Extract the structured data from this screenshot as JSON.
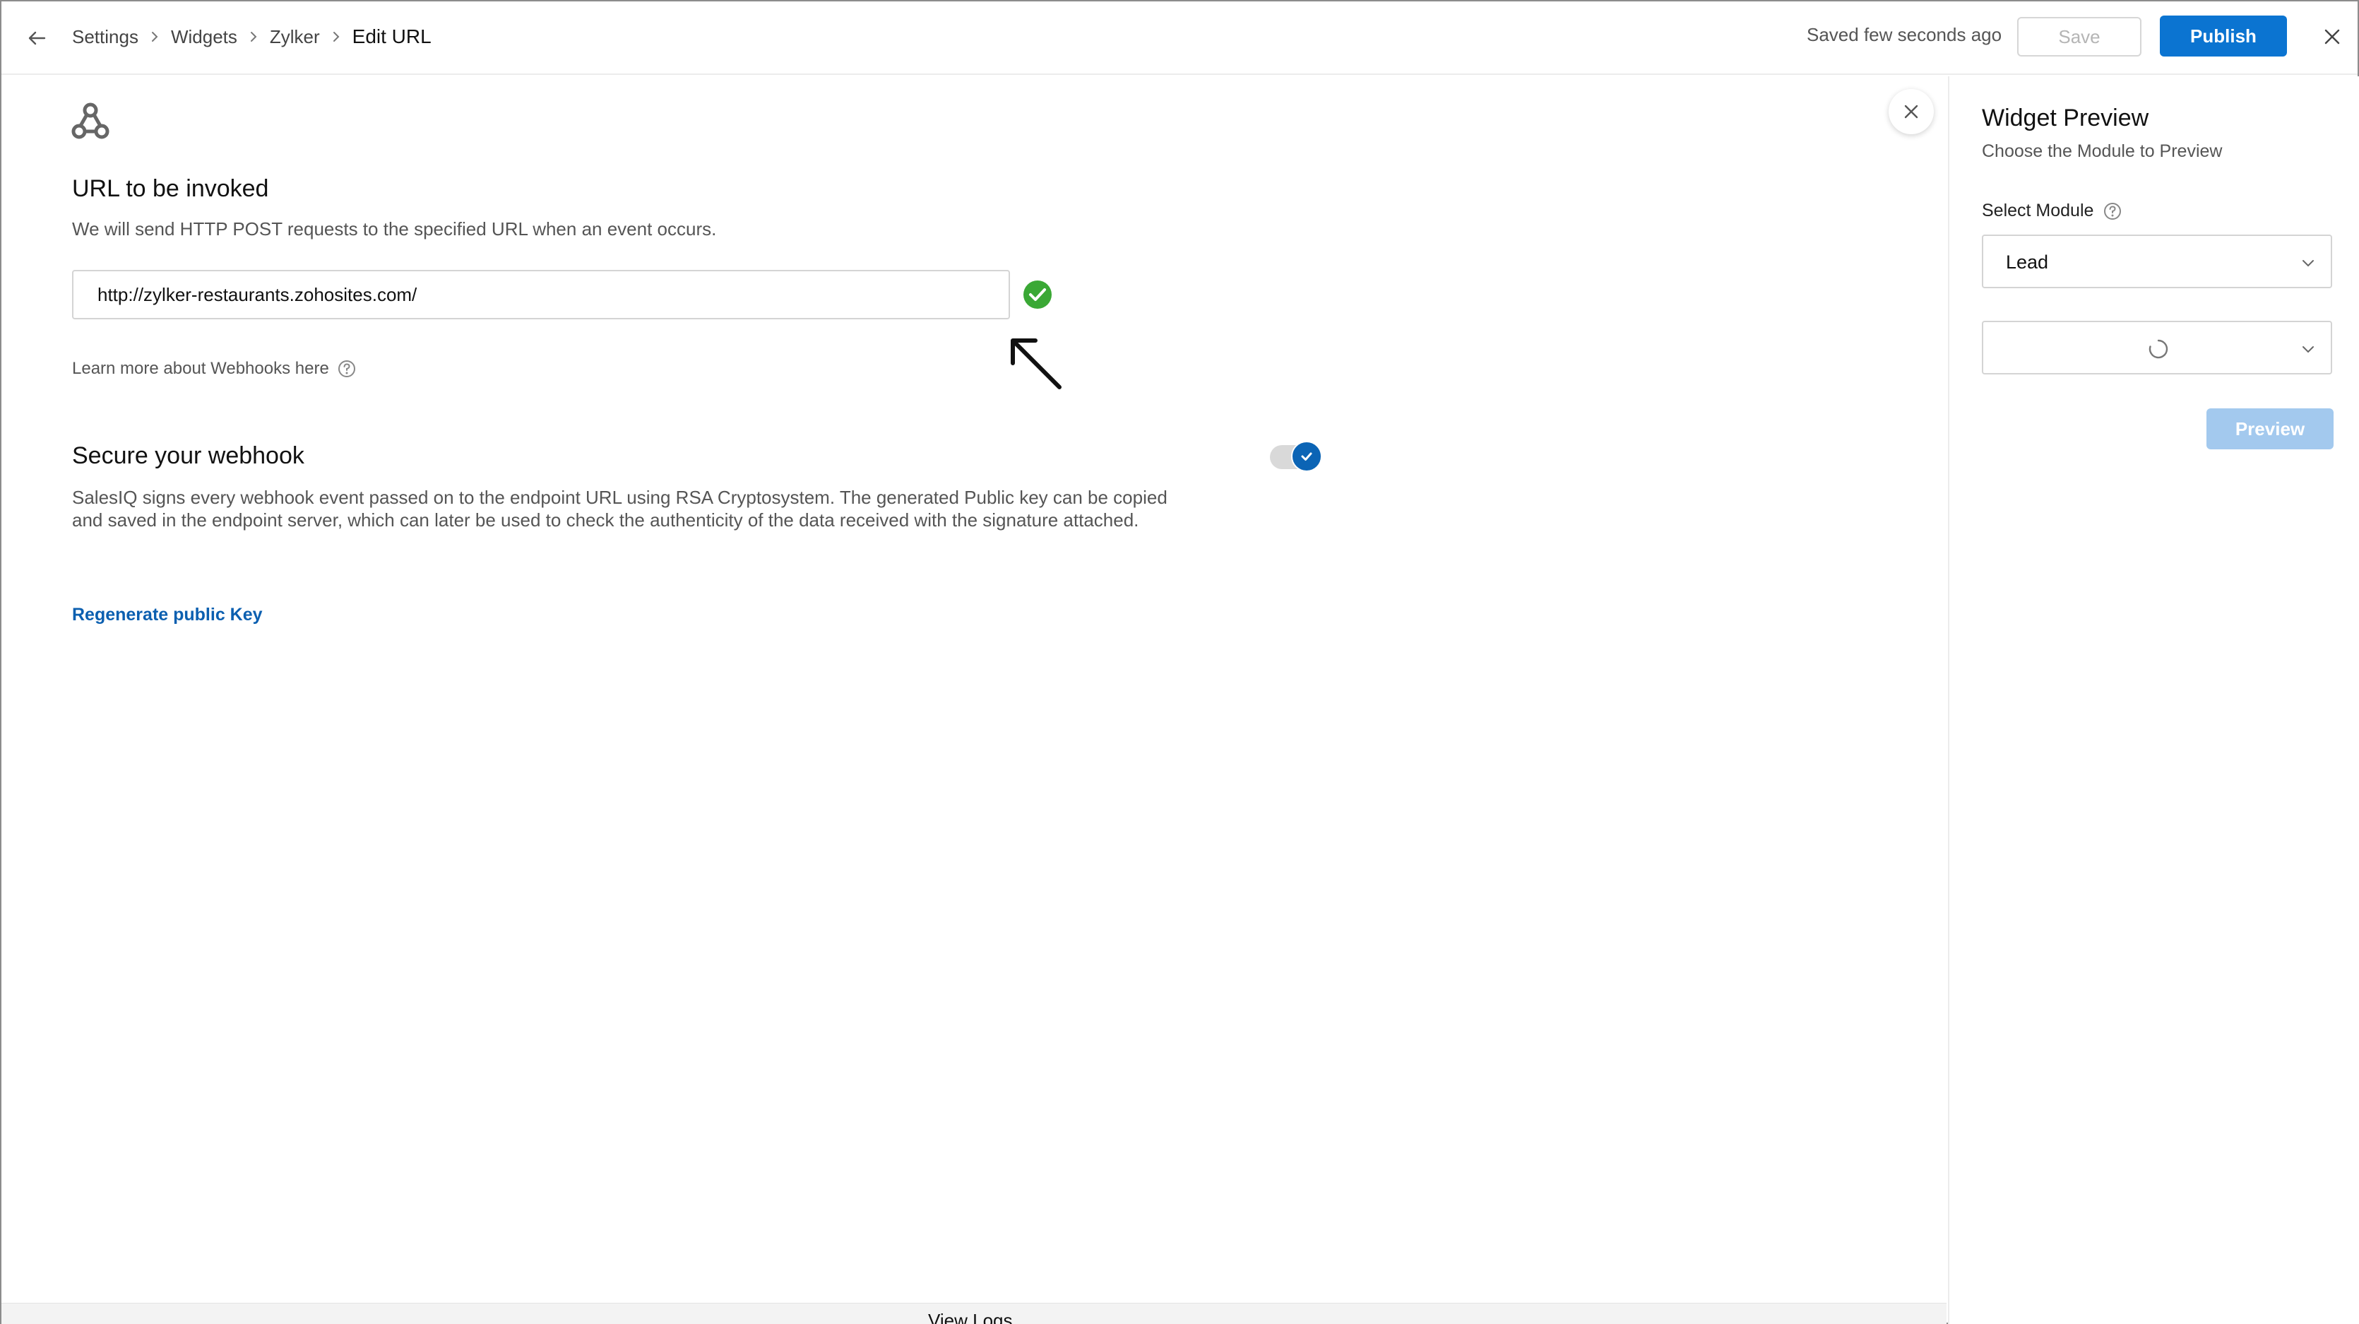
{
  "breadcrumb": {
    "items": [
      "Settings",
      "Widgets",
      "Zylker"
    ],
    "current": "Edit URL"
  },
  "header": {
    "saved_status": "Saved few seconds ago",
    "save_label": "Save",
    "publish_label": "Publish"
  },
  "url_section": {
    "title": "URL to be invoked",
    "description": "We will send HTTP POST requests to the specified URL when an event occurs.",
    "url_value": "http://zylker-restaurants.zohosites.com/",
    "learn_more": "Learn more about Webhooks here"
  },
  "secure_section": {
    "title": "Secure your webhook",
    "description": "SalesIQ signs every webhook event passed on to the endpoint URL using RSA Cryptosystem. The generated Public key can be copied and saved in the endpoint server, which can later be used to check the authenticity of the data received with the signature attached.",
    "toggle_on": true,
    "regenerate_label": "Regenerate public Key"
  },
  "footer": {
    "view_logs": "View Logs"
  },
  "preview_panel": {
    "title": "Widget Preview",
    "subtitle": "Choose the Module to Preview",
    "select_label": "Select Module",
    "module_value": "Lead",
    "record_value": "",
    "preview_label": "Preview"
  },
  "colors": {
    "primary": "#0b74d1",
    "toggle_on": "#0b64b5",
    "success": "#3aa835",
    "link": "#0b5fb0",
    "disabled_primary": "#a3c9ee"
  },
  "icons": {
    "back": "arrow-left-icon",
    "breadcrumb_separator": "chevron-right-icon",
    "close": "close-icon",
    "logo": "webhook-icon",
    "valid": "check-circle-icon",
    "help": "help-circle-icon",
    "dropdown": "chevron-down-icon",
    "loading": "spinner-icon"
  }
}
